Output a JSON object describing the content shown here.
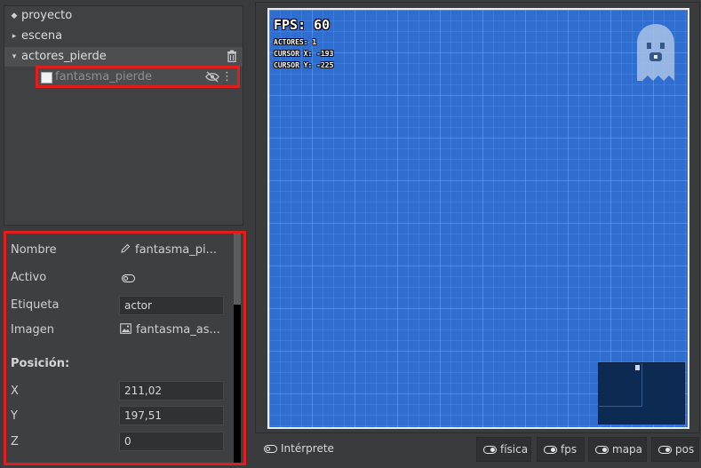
{
  "tree": {
    "items": [
      {
        "label": "proyecto",
        "marker": "◆"
      },
      {
        "label": "escena",
        "marker": "▸"
      },
      {
        "label": "actores_pierde",
        "marker": "▾"
      }
    ],
    "child": {
      "label": "fantasma_pierde",
      "menu": "⋮"
    }
  },
  "properties": {
    "nombre_label": "Nombre",
    "nombre_value": "fantasma_pi...",
    "activo_label": "Activo",
    "etiqueta_label": "Etiqueta",
    "etiqueta_value": "actor",
    "imagen_label": "Imagen",
    "imagen_value": "fantasma_as...",
    "posicion_heading": "Posición:",
    "x_label": "X",
    "x_value": "211,02",
    "y_label": "Y",
    "y_value": "197,51",
    "z_label": "Z",
    "z_value": "0"
  },
  "stage": {
    "fps": "FPS: 60",
    "actores": "ACTORES: 1",
    "cursor_x": "CURSOR X: -193",
    "cursor_y": "CURSOR Y: -225",
    "background_color": "#2f6ecf"
  },
  "toolbar": {
    "interprete": "Intérprete",
    "fisica": "física",
    "fps": "fps",
    "mapa": "mapa",
    "pos": "pos"
  },
  "colors": {
    "highlight": "#e11d1d",
    "panel": "#3d3f40"
  }
}
